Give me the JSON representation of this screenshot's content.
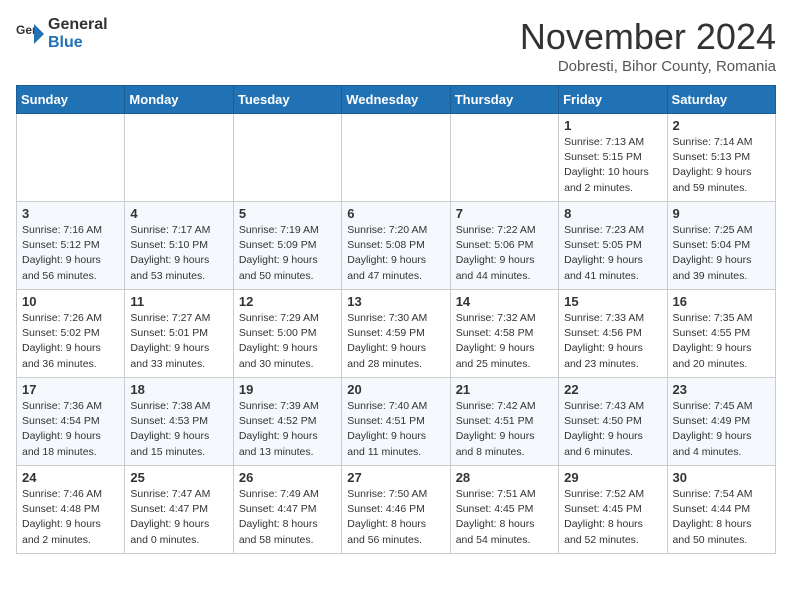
{
  "logo": {
    "general": "General",
    "blue": "Blue"
  },
  "title": "November 2024",
  "subtitle": "Dobresti, Bihor County, Romania",
  "weekdays": [
    "Sunday",
    "Monday",
    "Tuesday",
    "Wednesday",
    "Thursday",
    "Friday",
    "Saturday"
  ],
  "weeks": [
    [
      {
        "day": "",
        "info": ""
      },
      {
        "day": "",
        "info": ""
      },
      {
        "day": "",
        "info": ""
      },
      {
        "day": "",
        "info": ""
      },
      {
        "day": "",
        "info": ""
      },
      {
        "day": "1",
        "info": "Sunrise: 7:13 AM\nSunset: 5:15 PM\nDaylight: 10 hours\nand 2 minutes."
      },
      {
        "day": "2",
        "info": "Sunrise: 7:14 AM\nSunset: 5:13 PM\nDaylight: 9 hours\nand 59 minutes."
      }
    ],
    [
      {
        "day": "3",
        "info": "Sunrise: 7:16 AM\nSunset: 5:12 PM\nDaylight: 9 hours\nand 56 minutes."
      },
      {
        "day": "4",
        "info": "Sunrise: 7:17 AM\nSunset: 5:10 PM\nDaylight: 9 hours\nand 53 minutes."
      },
      {
        "day": "5",
        "info": "Sunrise: 7:19 AM\nSunset: 5:09 PM\nDaylight: 9 hours\nand 50 minutes."
      },
      {
        "day": "6",
        "info": "Sunrise: 7:20 AM\nSunset: 5:08 PM\nDaylight: 9 hours\nand 47 minutes."
      },
      {
        "day": "7",
        "info": "Sunrise: 7:22 AM\nSunset: 5:06 PM\nDaylight: 9 hours\nand 44 minutes."
      },
      {
        "day": "8",
        "info": "Sunrise: 7:23 AM\nSunset: 5:05 PM\nDaylight: 9 hours\nand 41 minutes."
      },
      {
        "day": "9",
        "info": "Sunrise: 7:25 AM\nSunset: 5:04 PM\nDaylight: 9 hours\nand 39 minutes."
      }
    ],
    [
      {
        "day": "10",
        "info": "Sunrise: 7:26 AM\nSunset: 5:02 PM\nDaylight: 9 hours\nand 36 minutes."
      },
      {
        "day": "11",
        "info": "Sunrise: 7:27 AM\nSunset: 5:01 PM\nDaylight: 9 hours\nand 33 minutes."
      },
      {
        "day": "12",
        "info": "Sunrise: 7:29 AM\nSunset: 5:00 PM\nDaylight: 9 hours\nand 30 minutes."
      },
      {
        "day": "13",
        "info": "Sunrise: 7:30 AM\nSunset: 4:59 PM\nDaylight: 9 hours\nand 28 minutes."
      },
      {
        "day": "14",
        "info": "Sunrise: 7:32 AM\nSunset: 4:58 PM\nDaylight: 9 hours\nand 25 minutes."
      },
      {
        "day": "15",
        "info": "Sunrise: 7:33 AM\nSunset: 4:56 PM\nDaylight: 9 hours\nand 23 minutes."
      },
      {
        "day": "16",
        "info": "Sunrise: 7:35 AM\nSunset: 4:55 PM\nDaylight: 9 hours\nand 20 minutes."
      }
    ],
    [
      {
        "day": "17",
        "info": "Sunrise: 7:36 AM\nSunset: 4:54 PM\nDaylight: 9 hours\nand 18 minutes."
      },
      {
        "day": "18",
        "info": "Sunrise: 7:38 AM\nSunset: 4:53 PM\nDaylight: 9 hours\nand 15 minutes."
      },
      {
        "day": "19",
        "info": "Sunrise: 7:39 AM\nSunset: 4:52 PM\nDaylight: 9 hours\nand 13 minutes."
      },
      {
        "day": "20",
        "info": "Sunrise: 7:40 AM\nSunset: 4:51 PM\nDaylight: 9 hours\nand 11 minutes."
      },
      {
        "day": "21",
        "info": "Sunrise: 7:42 AM\nSunset: 4:51 PM\nDaylight: 9 hours\nand 8 minutes."
      },
      {
        "day": "22",
        "info": "Sunrise: 7:43 AM\nSunset: 4:50 PM\nDaylight: 9 hours\nand 6 minutes."
      },
      {
        "day": "23",
        "info": "Sunrise: 7:45 AM\nSunset: 4:49 PM\nDaylight: 9 hours\nand 4 minutes."
      }
    ],
    [
      {
        "day": "24",
        "info": "Sunrise: 7:46 AM\nSunset: 4:48 PM\nDaylight: 9 hours\nand 2 minutes."
      },
      {
        "day": "25",
        "info": "Sunrise: 7:47 AM\nSunset: 4:47 PM\nDaylight: 9 hours\nand 0 minutes."
      },
      {
        "day": "26",
        "info": "Sunrise: 7:49 AM\nSunset: 4:47 PM\nDaylight: 8 hours\nand 58 minutes."
      },
      {
        "day": "27",
        "info": "Sunrise: 7:50 AM\nSunset: 4:46 PM\nDaylight: 8 hours\nand 56 minutes."
      },
      {
        "day": "28",
        "info": "Sunrise: 7:51 AM\nSunset: 4:45 PM\nDaylight: 8 hours\nand 54 minutes."
      },
      {
        "day": "29",
        "info": "Sunrise: 7:52 AM\nSunset: 4:45 PM\nDaylight: 8 hours\nand 52 minutes."
      },
      {
        "day": "30",
        "info": "Sunrise: 7:54 AM\nSunset: 4:44 PM\nDaylight: 8 hours\nand 50 minutes."
      }
    ]
  ]
}
